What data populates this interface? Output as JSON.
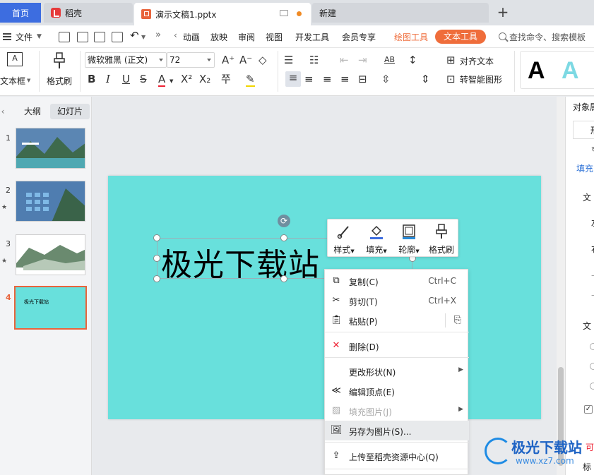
{
  "tabs": {
    "home": "首页",
    "wk": "稻壳",
    "doc": "演示文稿1.pptx",
    "new": "新建"
  },
  "menubar": {
    "file": "文件",
    "items": [
      "动画",
      "放映",
      "审阅",
      "视图",
      "开发工具",
      "会员专享"
    ],
    "draw_tool": "绘图工具",
    "text_tool": "文本工具",
    "search": "查找命令、搜索模板"
  },
  "ribbon": {
    "textbox": "文本框",
    "format_painter": "格式刷",
    "font_name": "微软雅黑 (正文)",
    "font_size": "72",
    "align_text": "对齐文本",
    "smart_shape": "转智能图形"
  },
  "left_panel": {
    "outline_tab": "大纲",
    "slides_tab": "幻灯片",
    "slides": [
      {
        "num": "1"
      },
      {
        "num": "2"
      },
      {
        "num": "3"
      },
      {
        "num": "4",
        "text": "极光下载站"
      }
    ]
  },
  "slide": {
    "text": "极光下载站"
  },
  "minibar": {
    "style": "样式",
    "fill": "填充",
    "outline": "轮廓",
    "painter": "格式刷"
  },
  "context_menu": {
    "copy": "复制(C)",
    "copy_shortcut": "Ctrl+C",
    "cut": "剪切(T)",
    "cut_shortcut": "Ctrl+X",
    "paste": "粘贴(P)",
    "delete": "删除(D)",
    "change_shape": "更改形状(N)",
    "edit_points": "编辑顶点(E)",
    "fill_picture": "填充图片(J)",
    "save_as_picture": "另存为图片(S)...",
    "upload": "上传至稻壳资源中心(Q)"
  },
  "right_pane": {
    "title": "对象属",
    "tab": "形",
    "fill": "填充",
    "text1": "文",
    "text2": "左",
    "text3": "右",
    "text4": "文",
    "text5": "可",
    "text6": "标"
  },
  "watermark": {
    "name": "极光下载站",
    "url": "www.xz7.com"
  },
  "colors": {
    "accent": "#3d6de0",
    "text_tool_pill": "#ef6d3b",
    "slide_bg": "#68e0dc"
  }
}
